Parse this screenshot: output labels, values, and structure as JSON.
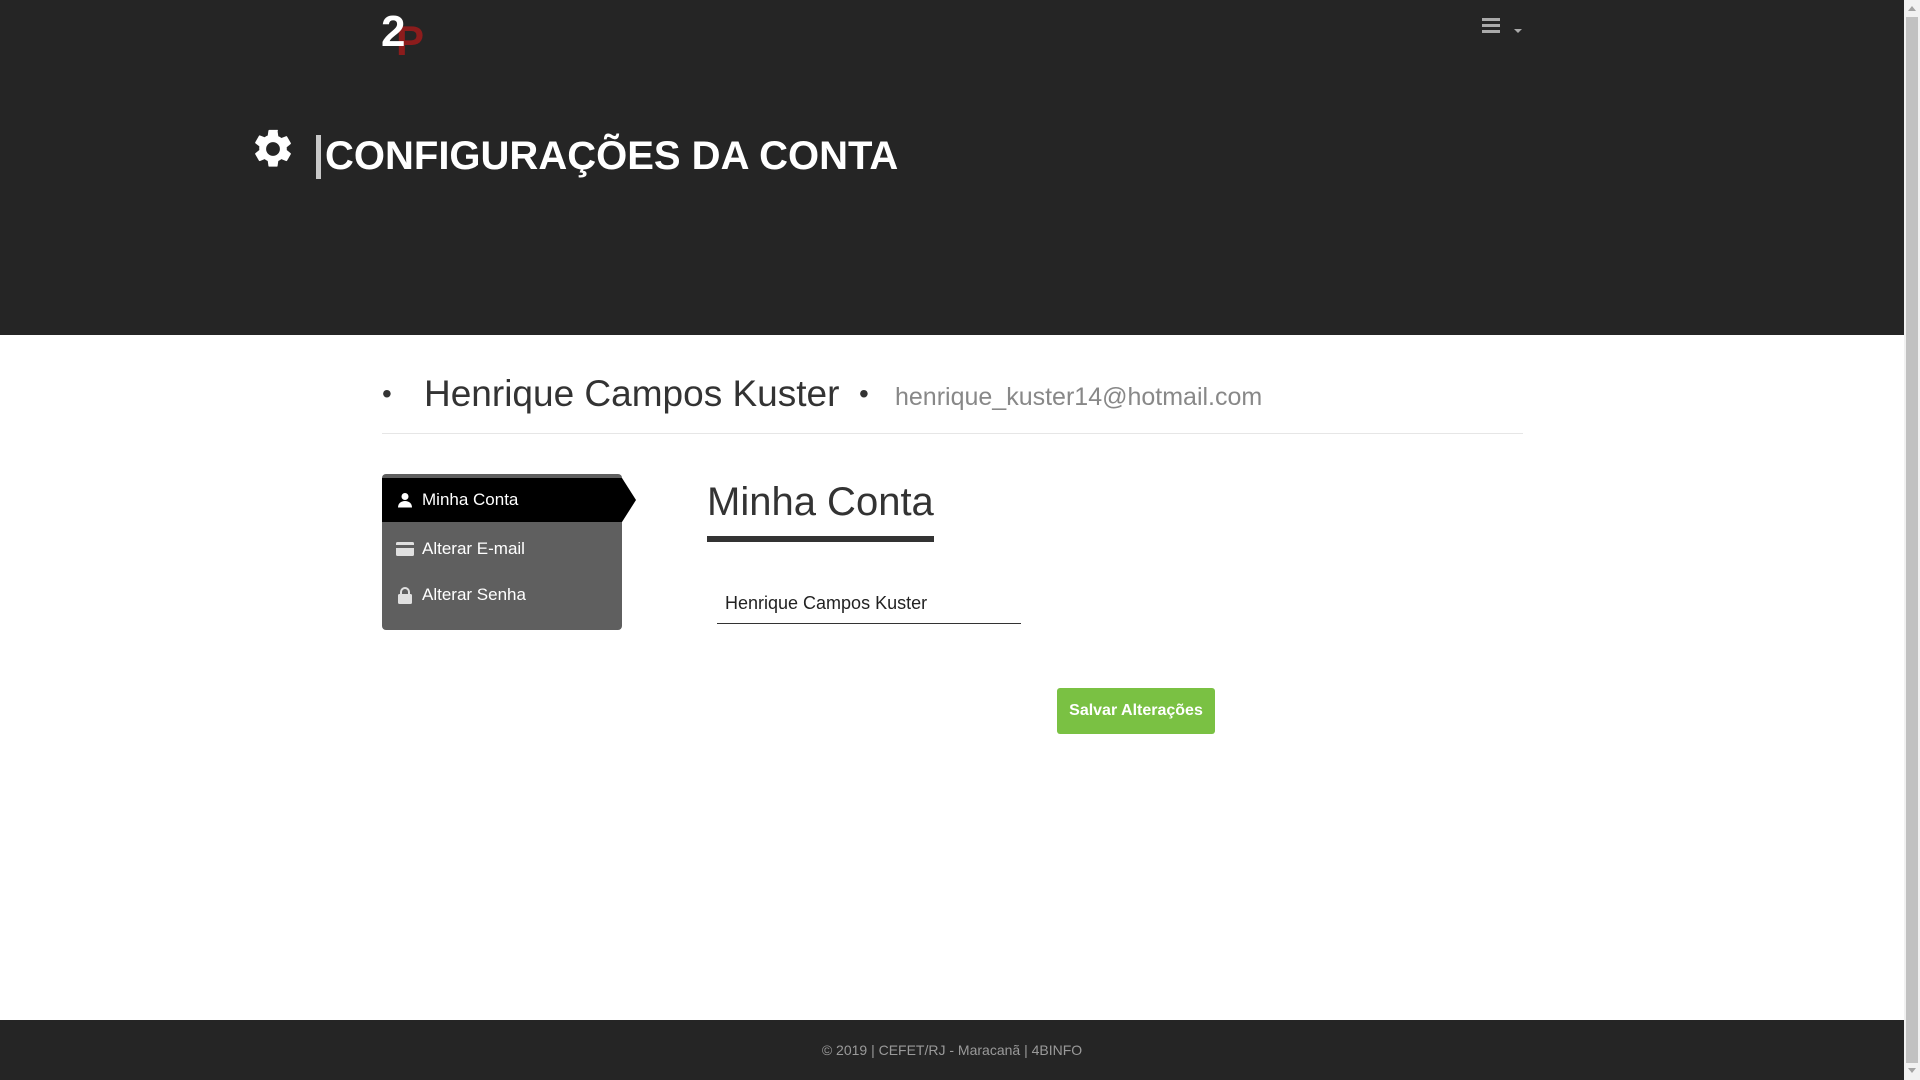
{
  "header": {
    "logo": {
      "digit": "2",
      "letter": "P",
      "icon": "app-logo"
    },
    "menu": {
      "icon": "hamburger-menu-icon",
      "has_caret": true
    },
    "page_title": "CONFIGURAÇÕES DA CONTA",
    "title_icon": "gear-icon"
  },
  "user": {
    "name": "Henrique Campos Kuster",
    "email": "henrique_kuster14@hotmail.com"
  },
  "sidebar": {
    "items": [
      {
        "label": "Minha Conta",
        "icon": "user-icon",
        "active": true
      },
      {
        "label": "Alterar E-mail",
        "icon": "credit-card-icon",
        "active": false
      },
      {
        "label": "Alterar Senha",
        "icon": "lock-icon",
        "active": false
      }
    ]
  },
  "main": {
    "section_title": "Minha Conta",
    "name_field": {
      "value": "Henrique Campos Kuster",
      "placeholder": ""
    },
    "save_label": "Salvar Alterações"
  },
  "footer": {
    "text": "© 2019 | CEFET/RJ - Maracanã | 4BINFO"
  },
  "colors": {
    "header_bg": "#252525",
    "accent_green": "#7ac143",
    "sidebar_bg": "#5f5f5f",
    "sidebar_active_bg": "#000000",
    "logo_red": "#8c1c1c"
  }
}
